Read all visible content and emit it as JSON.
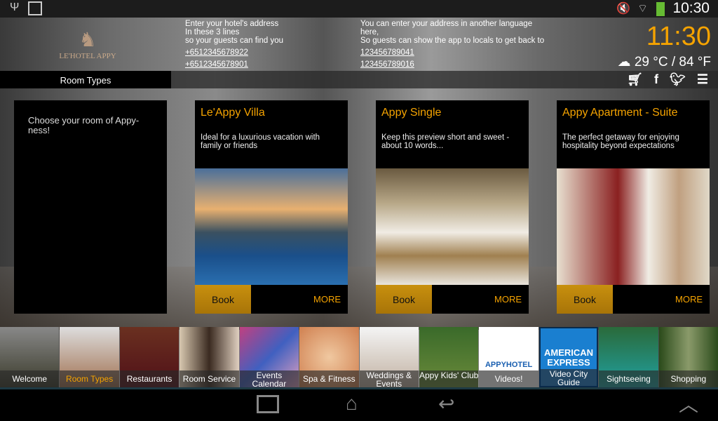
{
  "status": {
    "time": "10:30",
    "icons": [
      "usb-icon",
      "image-icon",
      "mute-icon",
      "wifi-icon",
      "battery-icon"
    ]
  },
  "header": {
    "logo": "LE'HOTEL APPY",
    "address": [
      "Enter your hotel's address",
      "In these 3 lines",
      "so your guests can find you"
    ],
    "phones": [
      "+6512345678922",
      "+6512345678901"
    ],
    "alt_address": [
      "You can enter your address in another language",
      "here,",
      "So guests can show the app to locals to get back to"
    ],
    "alt_phones": [
      "123456789041",
      "123456789016"
    ],
    "clock": "11:30",
    "weather": "29 °C / 84 °F"
  },
  "tabbar": {
    "current": "Room Types",
    "icons": [
      "cart-icon",
      "facebook-icon",
      "twitter-icon",
      "menu-icon"
    ]
  },
  "intro": "Choose your room of Appy-ness!",
  "cards": [
    {
      "title": "Le'Appy Villa",
      "desc": "Ideal for a luxurious vacation with family or friends",
      "book": "Book",
      "more": "MORE"
    },
    {
      "title": "Appy Single",
      "desc": "Keep this preview short and sweet - about 10 words...",
      "book": "Book",
      "more": "MORE"
    },
    {
      "title": "Appy Apartment - Suite",
      "desc": "The perfect getaway for enjoying hospitality beyond expectations",
      "book": "Book",
      "more": "MORE"
    }
  ],
  "thumbs": [
    "Welcome",
    "Room Types",
    "Restaurants",
    "Room Service",
    "Events Calendar",
    "Spa & Fitness",
    "Weddings & Events",
    "Appy Kids' Club",
    "Videos!",
    "Video City Guide",
    "Sightseeing",
    "Shopping"
  ],
  "thumb_extra": {
    "appyhotel": "APPYHOTEL",
    "amex1": "AMERICAN",
    "amex2": "EXPRESS"
  },
  "colors": {
    "accent": "#f5a300",
    "book": "#c8900e"
  }
}
